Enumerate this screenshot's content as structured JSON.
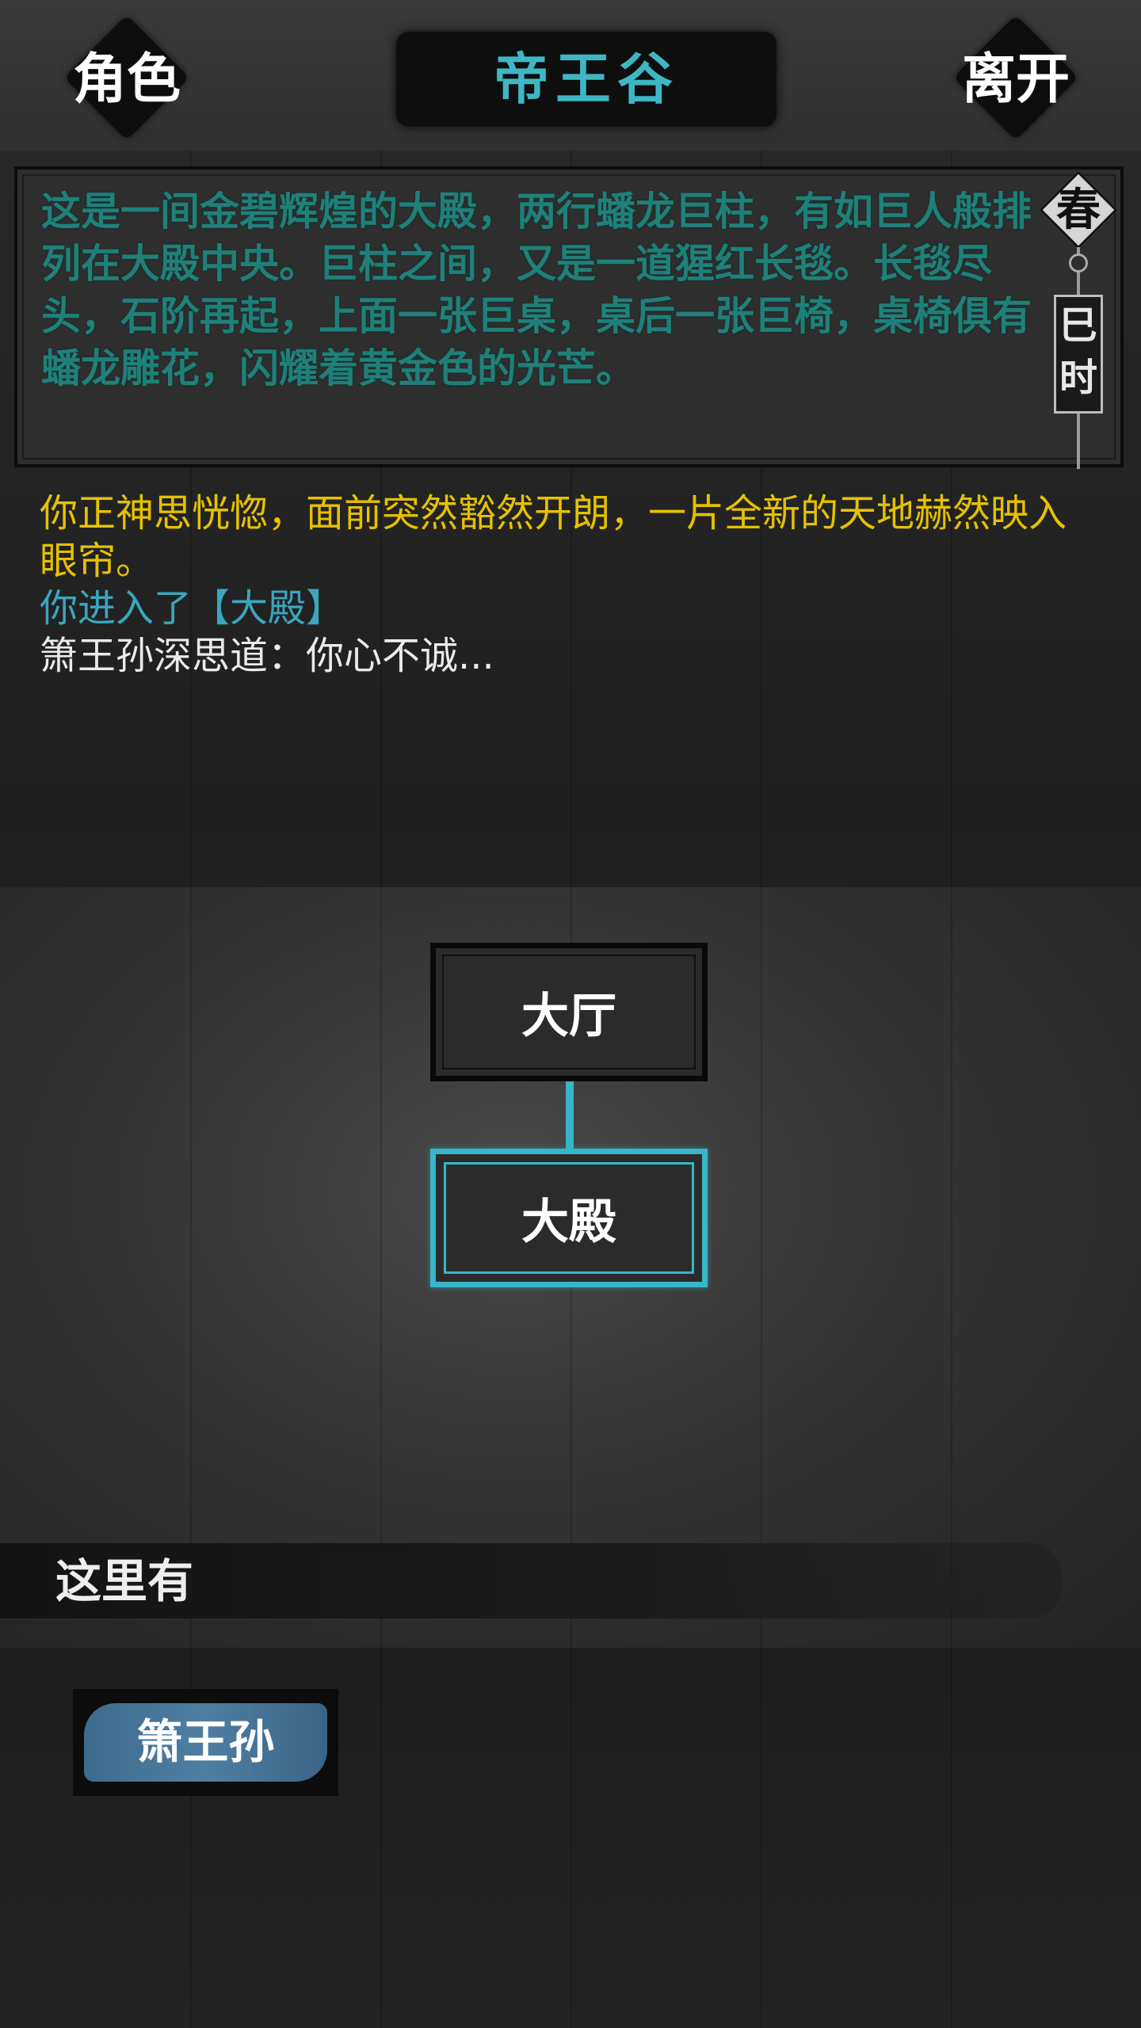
{
  "header": {
    "left_button": "角色",
    "title": "帝王谷",
    "right_button": "离开"
  },
  "description": "这是一间金碧辉煌的大殿，两行蟠龙巨柱，有如巨人般排列在大殿中央。巨柱之间，又是一道猩红长毯。长毯尽头，石阶再起，上面一张巨桌，桌后一张巨椅，桌椅俱有蟠龙雕花，闪耀着黄金色的光芒。",
  "time": {
    "season": "春",
    "hour": "巳时"
  },
  "messages": [
    {
      "text": "你正神思恍惚，面前突然豁然开朗，一片全新的天地赫然映入眼帘。",
      "color": "#e5c100"
    },
    {
      "text": "你进入了【大殿】",
      "color": "#3aa6bd"
    },
    {
      "text": "箫王孙深思道：你心不诚...",
      "color": "#eaeaea"
    }
  ],
  "map": {
    "rooms": [
      {
        "name": "大厅",
        "current": false
      },
      {
        "name": "大殿",
        "current": true
      }
    ]
  },
  "here": {
    "label": "这里有",
    "npcs": [
      "箫王孙"
    ]
  },
  "colors": {
    "accent_cyan": "#36b6c8",
    "desc_green": "#1f8078",
    "msg_yellow": "#e5c100",
    "npc_blue": "#4f7fa3"
  }
}
